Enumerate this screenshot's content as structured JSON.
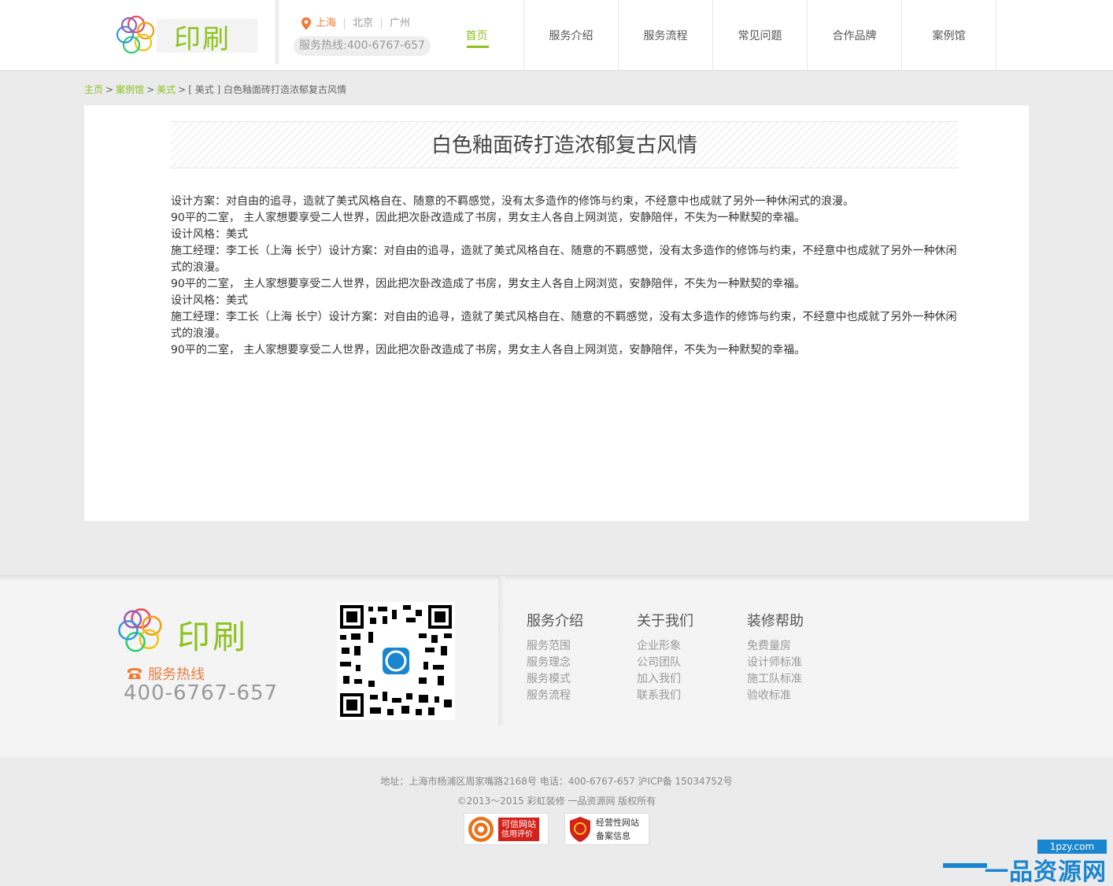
{
  "header": {
    "logo_text": "印刷",
    "cities": [
      "上海",
      "北京",
      "广州"
    ],
    "hotline": "服务热线:400-6767-657",
    "nav": [
      {
        "label": "首页",
        "active": true
      },
      {
        "label": "服务介绍"
      },
      {
        "label": "服务流程"
      },
      {
        "label": "常见问题"
      },
      {
        "label": "合作品牌"
      },
      {
        "label": "案例馆"
      }
    ]
  },
  "breadcrumb": {
    "home": "主页",
    "gallery": "案例馆",
    "style": "美式",
    "current": "[ 美式 ] 白色釉面砖打造浓郁复古风情"
  },
  "article": {
    "title": "白色釉面砖打造浓郁复古风情",
    "paragraphs": [
      "设计方案：对自由的追寻，造就了美式风格自在、随意的不羁感觉，没有太多造作的修饰与约束，不经意中也成就了另外一种休闲式的浪漫。",
      "90平的二室， 主人家想要享受二人世界，因此把次卧改造成了书房，男女主人各自上网浏览，安静陪伴，不失为一种默契的幸福。",
      "设计风格：美式",
      "施工经理：李工长（上海 长宁）设计方案：对自由的追寻，造就了美式风格自在、随意的不羁感觉，没有太多造作的修饰与约束，不经意中也成就了另外一种休闲式的浪漫。",
      "90平的二室， 主人家想要享受二人世界，因此把次卧改造成了书房，男女主人各自上网浏览，安静陪伴，不失为一种默契的幸福。",
      "设计风格：美式",
      "施工经理：李工长（上海 长宁）设计方案：对自由的追寻，造就了美式风格自在、随意的不羁感觉，没有太多造作的修饰与约束，不经意中也成就了另外一种休闲式的浪漫。",
      "90平的二室， 主人家想要享受二人世界，因此把次卧改造成了书房，男女主人各自上网浏览，安静陪伴，不失为一种默契的幸福。"
    ]
  },
  "footer": {
    "logo_text": "印刷",
    "hotline_label": "服务热线",
    "hotline_number": "400-6767-657",
    "columns": [
      {
        "title": "服务介绍",
        "links": [
          "服务范围",
          "服务理念",
          "服务模式",
          "服务流程"
        ]
      },
      {
        "title": "关于我们",
        "links": [
          "企业形象",
          "公司团队",
          "加入我们",
          "联系我们"
        ]
      },
      {
        "title": "装修帮助",
        "links": [
          "免费量房",
          "设计师标准",
          "施工队标准",
          "验收标准"
        ]
      }
    ]
  },
  "bottom": {
    "address_line": "地址：上海市杨浦区周家嘴路2168号  电话：400-6767-657  沪ICP备 15034752号",
    "copyright_line": "©2013～2015 彩虹装修 一品资源网 版权所有",
    "badge1_text": [
      "可信网站",
      "信用评价"
    ],
    "badge2_text": [
      "经营性网站",
      "备案信息"
    ]
  },
  "watermark": {
    "domain": "1pzy.com",
    "text": "一品资源网"
  },
  "colors": {
    "accent": "#8dc21f",
    "orange": "#f07c3a",
    "watermark_blue": "#1a86d0"
  }
}
